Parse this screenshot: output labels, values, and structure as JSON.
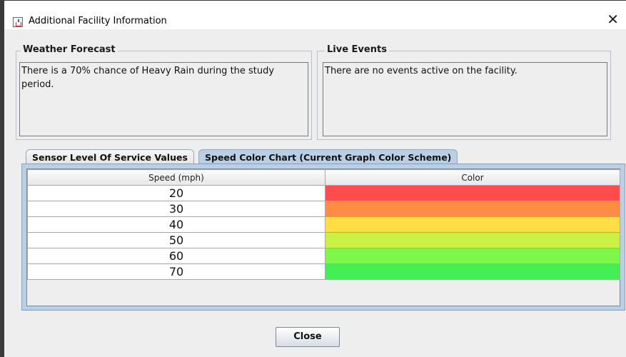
{
  "window": {
    "title": "Additional Facility Information",
    "close_glyph": "✕"
  },
  "weather": {
    "title": "Weather Forecast",
    "text": "There is a 70% chance of Heavy Rain during the study period."
  },
  "events": {
    "title": "Live Events",
    "text": "There are no events active on the facility."
  },
  "tabs": [
    {
      "label": "Sensor Level Of Service Values",
      "selected": false
    },
    {
      "label": "Speed Color Chart (Current Graph Color Scheme)",
      "selected": true
    }
  ],
  "table": {
    "columns": [
      "Speed (mph)",
      "Color"
    ],
    "rows": [
      {
        "speed": "20",
        "color": "#ff4c4c"
      },
      {
        "speed": "30",
        "color": "#ff8c44"
      },
      {
        "speed": "40",
        "color": "#ffdd44"
      },
      {
        "speed": "50",
        "color": "#ccf043"
      },
      {
        "speed": "60",
        "color": "#7ef64a"
      },
      {
        "speed": "70",
        "color": "#44ee55"
      }
    ]
  },
  "footer": {
    "close_label": "Close"
  }
}
